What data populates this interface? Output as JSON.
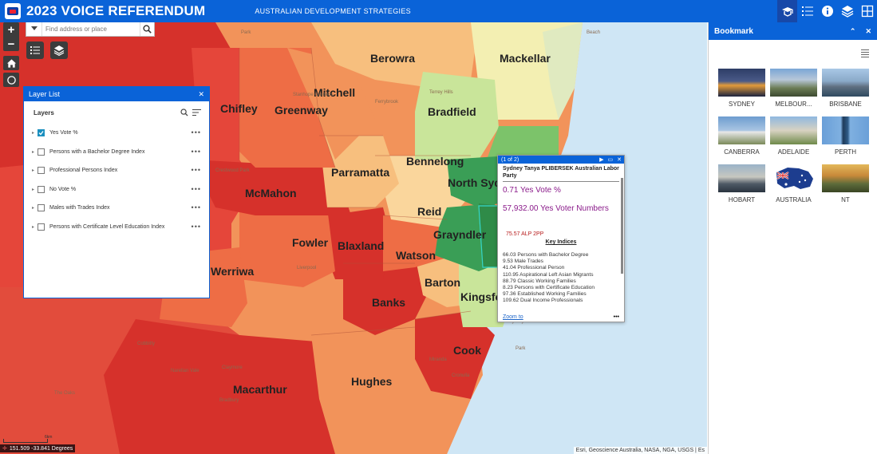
{
  "header": {
    "title": "2023 VOICE REFERENDUM",
    "subtitle": "AUSTRALIAN DEVELOPMENT STRATEGIES",
    "tools": [
      "legend-icon",
      "layer-list-icon",
      "about-icon",
      "layers-icon",
      "bookmark-icon"
    ]
  },
  "search": {
    "placeholder": "Find address or place"
  },
  "layer_list": {
    "title": "Layer List",
    "header": "Layers",
    "layers": [
      {
        "label": "Yes Vote %",
        "checked": true
      },
      {
        "label": "Persons with a Bachelor Degree Index",
        "checked": false
      },
      {
        "label": "Professional Persons Index",
        "checked": false
      },
      {
        "label": "No Vote %",
        "checked": false
      },
      {
        "label": "Males with Trades Index",
        "checked": false
      },
      {
        "label": "Persons with Certificate Level Education Index",
        "checked": false
      }
    ]
  },
  "map": {
    "electorates": [
      "Berowra",
      "Mackellar",
      "Mitchell",
      "Chifley",
      "Greenway",
      "Bradfield",
      "Bennelong",
      "Parramatta",
      "North Sydney",
      "McMahon",
      "Reid",
      "Fowler",
      "Blaxland",
      "Grayndler",
      "Watson",
      "Werriwa",
      "Barton",
      "Kingsford Smith",
      "Banks",
      "Cook",
      "Hughes",
      "Macarthur"
    ],
    "places": [
      "Park",
      "Beach",
      "Stanhope Gardens",
      "Terrey Hills",
      "Ferrybrook",
      "Crestwood Park",
      "Liverpool",
      "Botany Bay",
      "Sydney",
      "Cobbitty",
      "Narellan Vale",
      "Claymore",
      "Bradbury",
      "The Oaks",
      "Miranda",
      "Cronulla",
      "Botany Bay",
      "Park"
    ],
    "colors": {
      "darkred": "#d6312b",
      "red": "#e5463a",
      "orangered": "#ee6d45",
      "orange": "#f2935a",
      "lightorange": "#f7bf7e",
      "paleorange": "#fad69c",
      "yellowish": "#f3efb2",
      "lightgreen": "#c9e59a",
      "green": "#7cc36a",
      "darkgreen": "#3a9e56",
      "water": "#cfe6f5"
    }
  },
  "popup": {
    "counter": "(1 of 2)",
    "title": "Sydney Tanya PLIBERSEK Australian Labor Party",
    "yes_vote": "0.71  Yes Vote %",
    "yes_numbers": "57,932.00 Yes Voter Numbers",
    "alp": "75.57  ALP 2PP",
    "key_indices": "Key Indices",
    "indices": [
      "66.03 Persons with Bachelor Degree",
      "9.53 Male Trades",
      "41.04 Professional Person",
      "110.95 Aspirational Left Asian Migrants",
      "88.79 Classic Working Families",
      "8.23 Persons with Certificate Education",
      "97.36 Established Working Families",
      "109.62  Dual Income Professionals"
    ],
    "zoom_to": "Zoom to",
    "more": "•••"
  },
  "attribution": "Esri, Geoscience Australia, NASA, NGA, USGS | Es",
  "coordinates": "151.509 -33.841 Degrees",
  "scale": "6km",
  "bookmark": {
    "title": "Bookmark",
    "items": [
      {
        "name": "SYDNEY"
      },
      {
        "name": "MELBOUR..."
      },
      {
        "name": "BRISBANE"
      },
      {
        "name": "CANBERRA"
      },
      {
        "name": "ADELAIDE"
      },
      {
        "name": "PERTH"
      },
      {
        "name": "HOBART"
      },
      {
        "name": "AUSTRALIA"
      },
      {
        "name": "NT"
      }
    ]
  }
}
